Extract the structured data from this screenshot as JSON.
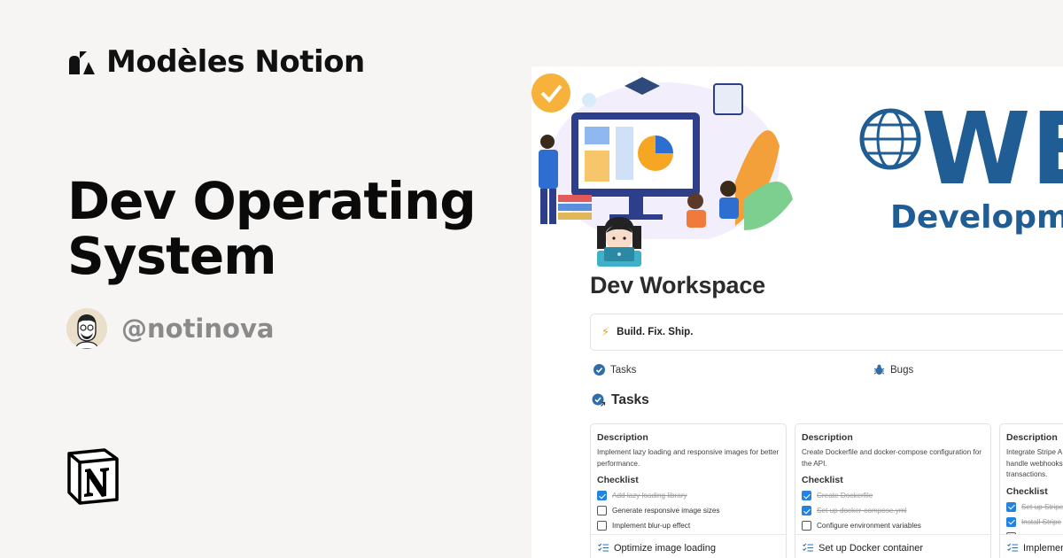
{
  "brand": {
    "name": "Modèles Notion",
    "logo_icon": "shapes-logo-icon"
  },
  "hero": {
    "title": "Dev Operating System"
  },
  "author": {
    "handle": "@notinova",
    "avatar_icon": "avatar-illustration"
  },
  "notion_logo_icon": "notion-logo-icon",
  "workspace": {
    "cover_text": "WE",
    "cover_subtext": "Developme",
    "page_icon": "developer-emoji-icon",
    "title": "Dev Workspace",
    "callout": {
      "icon": "lightning-icon",
      "text": "Build. Fix. Ship."
    },
    "links": [
      {
        "icon": "check-circle-icon",
        "label": "Tasks"
      },
      {
        "icon": "bug-icon",
        "label": "Bugs"
      }
    ],
    "section": {
      "icon": "check-circle-icon",
      "title": "Tasks"
    },
    "cards": [
      {
        "description_label": "Description",
        "description": "Implement lazy loading and responsive images for better performance.",
        "checklist_label": "Checklist",
        "items": [
          {
            "text": "Add lazy loading library",
            "done": true
          },
          {
            "text": "Generate responsive image sizes",
            "done": false
          },
          {
            "text": "Implement blur-up effect",
            "done": false
          }
        ],
        "footer": "Optimize image loading"
      },
      {
        "description_label": "Description",
        "description": "Create Dockerfile and docker-compose configuration for the API.",
        "checklist_label": "Checklist",
        "items": [
          {
            "text": "Create Dockerfile",
            "done": true
          },
          {
            "text": "Set up docker-compose.yml",
            "done": true
          },
          {
            "text": "Configure environment variables",
            "done": false
          }
        ],
        "footer": "Set up Docker container"
      },
      {
        "description_label": "Description",
        "description": "Integrate Stripe A handle webhooks transactions.",
        "checklist_label": "Checklist",
        "items": [
          {
            "text": "Set up Stripe",
            "done": true
          },
          {
            "text": "Install Stripe",
            "done": true
          },
          {
            "text": "",
            "done": false
          }
        ],
        "footer": "Implemen"
      }
    ]
  },
  "colors": {
    "background": "#f6f5f4",
    "accent_blue": "#2383e2",
    "web_blue": "#1f5d94",
    "handle_gray": "#8a8a8a"
  }
}
